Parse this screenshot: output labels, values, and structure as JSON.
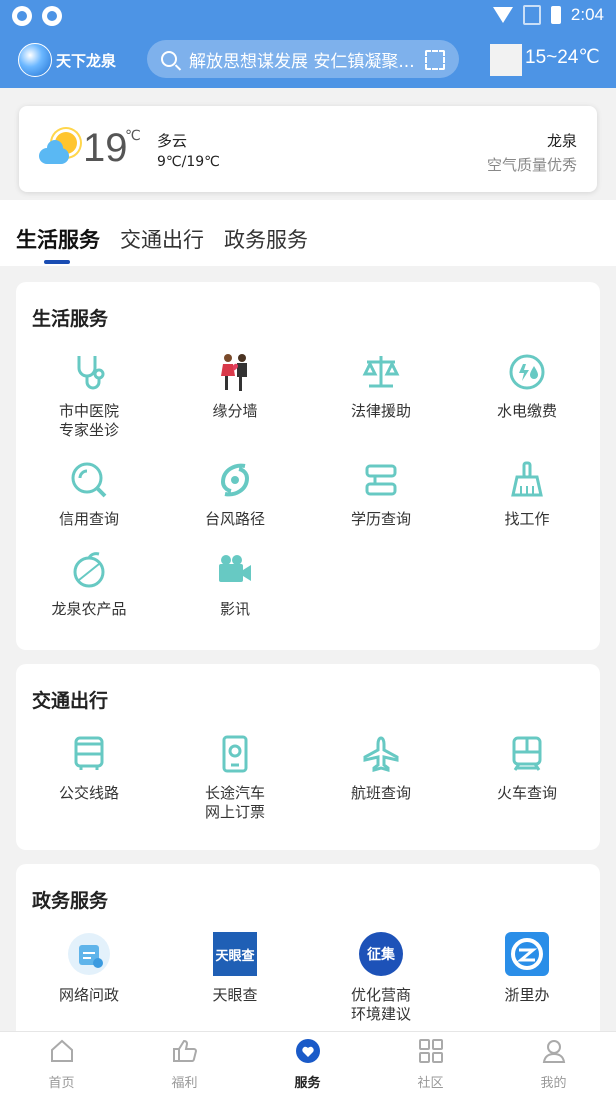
{
  "status_bar": {
    "time": "2:04"
  },
  "header": {
    "logo_text": "天下龙泉",
    "search_placeholder": "解放思想谋发展 安仁镇凝聚...",
    "temp_range": "15~24℃"
  },
  "weather": {
    "temp": "19",
    "unit": "℃",
    "desc": "多云",
    "range": "9℃/19℃",
    "city": "龙泉",
    "aqi": "空气质量优秀"
  },
  "tabs": [
    "生活服务",
    "交通出行",
    "政务服务"
  ],
  "sections": {
    "life": {
      "title": "生活服务",
      "items": [
        {
          "label": "市中医院\n专家坐诊",
          "icon": "stethoscope-icon"
        },
        {
          "label": "缘分墙",
          "icon": "couple-icon"
        },
        {
          "label": "法律援助",
          "icon": "scale-icon"
        },
        {
          "label": "水电缴费",
          "icon": "utility-icon"
        },
        {
          "label": "信用查询",
          "icon": "credit-search-icon"
        },
        {
          "label": "台风路径",
          "icon": "typhoon-icon"
        },
        {
          "label": "学历查询",
          "icon": "education-icon"
        },
        {
          "label": "找工作",
          "icon": "broom-icon"
        },
        {
          "label": "龙泉农产品",
          "icon": "fruit-icon"
        },
        {
          "label": "影讯",
          "icon": "camera-icon"
        }
      ]
    },
    "traffic": {
      "title": "交通出行",
      "items": [
        {
          "label": "公交线路",
          "icon": "bus-icon"
        },
        {
          "label": "长途汽车\n网上订票",
          "icon": "ticket-phone-icon"
        },
        {
          "label": "航班查询",
          "icon": "plane-icon"
        },
        {
          "label": "火车查询",
          "icon": "train-icon"
        }
      ]
    },
    "gov": {
      "title": "政务服务",
      "items": [
        {
          "label": "网络问政",
          "icon": "inquiry-icon",
          "badge_text": ""
        },
        {
          "label": "天眼查",
          "icon": "tianyancha-logo",
          "badge_text": "天眼查"
        },
        {
          "label": "优化营商\n环境建议",
          "icon": "collect-icon",
          "badge_text": "征集"
        },
        {
          "label": "浙里办",
          "icon": "zheliban-logo",
          "badge_text": ""
        }
      ]
    }
  },
  "bottom_nav": [
    {
      "label": "首页",
      "icon": "home-icon"
    },
    {
      "label": "福利",
      "icon": "thumbs-up-icon"
    },
    {
      "label": "服务",
      "icon": "heart-service-icon"
    },
    {
      "label": "社区",
      "icon": "grid-icon"
    },
    {
      "label": "我的",
      "icon": "profile-icon"
    }
  ],
  "colors": {
    "accent": "#4d94e5",
    "icon_teal": "#67c9c3",
    "tab_underline": "#1a4db3"
  }
}
